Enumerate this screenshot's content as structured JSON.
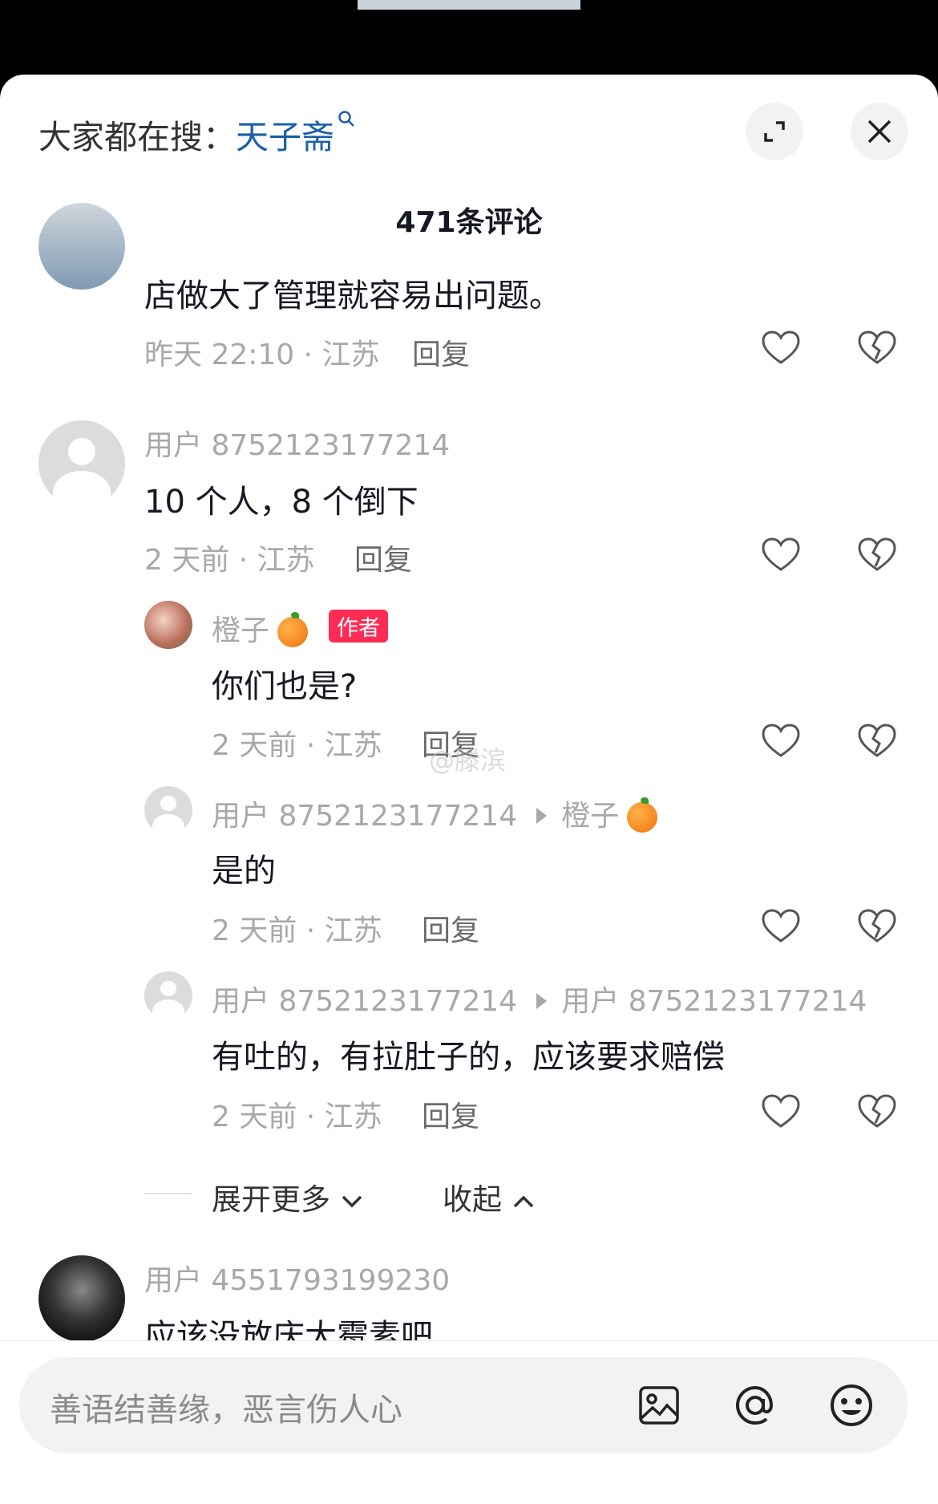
{
  "search": {
    "prefix": "大家都在搜：",
    "term": "天子斋"
  },
  "comment_count": "471条评论",
  "comments": [
    {
      "text": "店做大了管理就容易出问题。",
      "meta": "昨天 22:10 · 江苏",
      "reply": "回复"
    },
    {
      "user": "用户 8752123177214",
      "text": "10 个人，8 个倒下",
      "meta": "2 天前 · 江苏",
      "reply": "回复",
      "replies": [
        {
          "user": "橙子",
          "badge": "作者",
          "text": "你们也是?",
          "meta": "2 天前 · 江苏",
          "reply": "回复"
        },
        {
          "user": "用户 8752123177214",
          "to": "橙子",
          "text": "是的",
          "meta": "2 天前 · 江苏",
          "reply": "回复"
        },
        {
          "user": "用户 8752123177214",
          "to": "用户 8752123177214",
          "text": "有吐的，有拉肚子的，应该要求赔偿",
          "meta": "2 天前 · 江苏",
          "reply": "回复"
        }
      ]
    },
    {
      "user": "用户 4551793199230",
      "text": "应该没放庆大霉素吧"
    }
  ],
  "expand_more": "展开更多",
  "collapse": "收起",
  "watermark": "@滕滨",
  "input": {
    "placeholder": "善语结善缘，恶言伤人心"
  },
  "colors": {
    "accent": "#fe2c55",
    "link": "#1a5fa8",
    "text": "#161823",
    "muted": "#a8a8a8"
  },
  "icons": [
    "expand-icon",
    "close-icon",
    "heart-icon",
    "broken-heart-icon",
    "image-icon",
    "at-icon",
    "emoji-icon"
  ]
}
